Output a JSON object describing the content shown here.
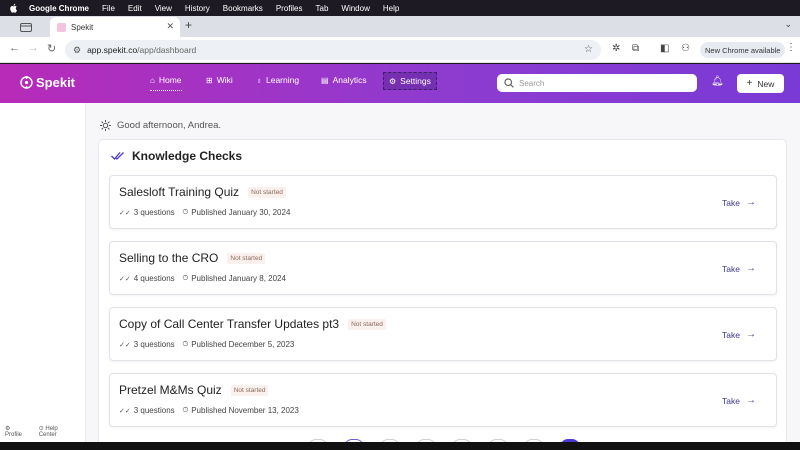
{
  "menubar": {
    "app": "Google Chrome",
    "items": [
      "File",
      "Edit",
      "View",
      "History",
      "Bookmarks",
      "Profiles",
      "Tab",
      "Window",
      "Help"
    ]
  },
  "browser": {
    "tab_title": "Spekit",
    "url_host": "app.spekit.co",
    "url_path": "/app/dashboard",
    "update_label": "New Chrome available"
  },
  "header": {
    "logo": "Spekit",
    "nav": [
      {
        "label": "Home",
        "icon": "home-icon"
      },
      {
        "label": "Wiki",
        "icon": "grid-icon"
      },
      {
        "label": "Learning",
        "icon": "lightbulb-icon"
      },
      {
        "label": "Analytics",
        "icon": "chart-icon"
      },
      {
        "label": "Settings",
        "icon": "gear-icon"
      }
    ],
    "search_placeholder": "Search",
    "new_label": "New"
  },
  "greeting": "Good afternoon, Andrea.",
  "knowledge_checks": {
    "title": "Knowledge Checks",
    "items": [
      {
        "title": "Salesloft Training Quiz",
        "status": "Not started",
        "questions": "3 questions",
        "published": "Published January 30, 2024",
        "action": "Take"
      },
      {
        "title": "Selling to the CRO",
        "status": "Not started",
        "questions": "4 questions",
        "published": "Published January 8, 2024",
        "action": "Take"
      },
      {
        "title": "Copy of Call Center Transfer Updates pt3",
        "status": "Not started",
        "questions": "3 questions",
        "published": "Published December 5, 2023",
        "action": "Take"
      },
      {
        "title": "Pretzel M&Ms Quiz",
        "status": "Not started",
        "questions": "3 questions",
        "published": "Published November 13, 2023",
        "action": "Take"
      }
    ]
  },
  "sidebar_footer": {
    "profile": "Profile",
    "help": "Help Center"
  },
  "colors": {
    "brand_gradient_start": "#b72bb8",
    "brand_gradient_end": "#7a3ad6",
    "take_link": "#3c3a8c"
  }
}
